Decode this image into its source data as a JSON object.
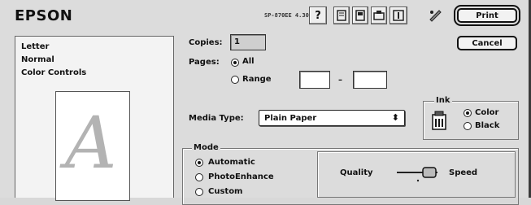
{
  "header": {
    "brand": "EPSON",
    "version": "SP-870EE 4.30E",
    "toolbar": [
      {
        "name": "help-icon",
        "glyph": "?"
      },
      {
        "name": "utility-icon-1",
        "glyph": ""
      },
      {
        "name": "utility-icon-2",
        "glyph": ""
      },
      {
        "name": "utility-icon-3",
        "glyph": ""
      },
      {
        "name": "utility-icon-4",
        "glyph": ""
      },
      {
        "name": "utility-icon-5",
        "glyph": ""
      }
    ],
    "print_label": "Print",
    "cancel_label": "Cancel"
  },
  "summary": {
    "paper": "Letter",
    "media": "Normal",
    "color": "Color Controls",
    "preview_letter": "A"
  },
  "copies": {
    "label": "Copies:",
    "value": "1"
  },
  "pages": {
    "label": "Pages:",
    "all": "All",
    "range": "Range",
    "from": "",
    "to": "",
    "dash": "–",
    "selected": "all"
  },
  "media_type": {
    "label": "Media Type:",
    "value": "Plain Paper",
    "arrow": "⬍"
  },
  "ink": {
    "title": "Ink",
    "color": "Color",
    "black": "Black",
    "selected": "color"
  },
  "mode": {
    "title": "Mode",
    "options": [
      "Automatic",
      "PhotoEnhance",
      "Custom"
    ],
    "selected": "Automatic",
    "quality_label": "Quality",
    "speed_label": "Speed"
  }
}
